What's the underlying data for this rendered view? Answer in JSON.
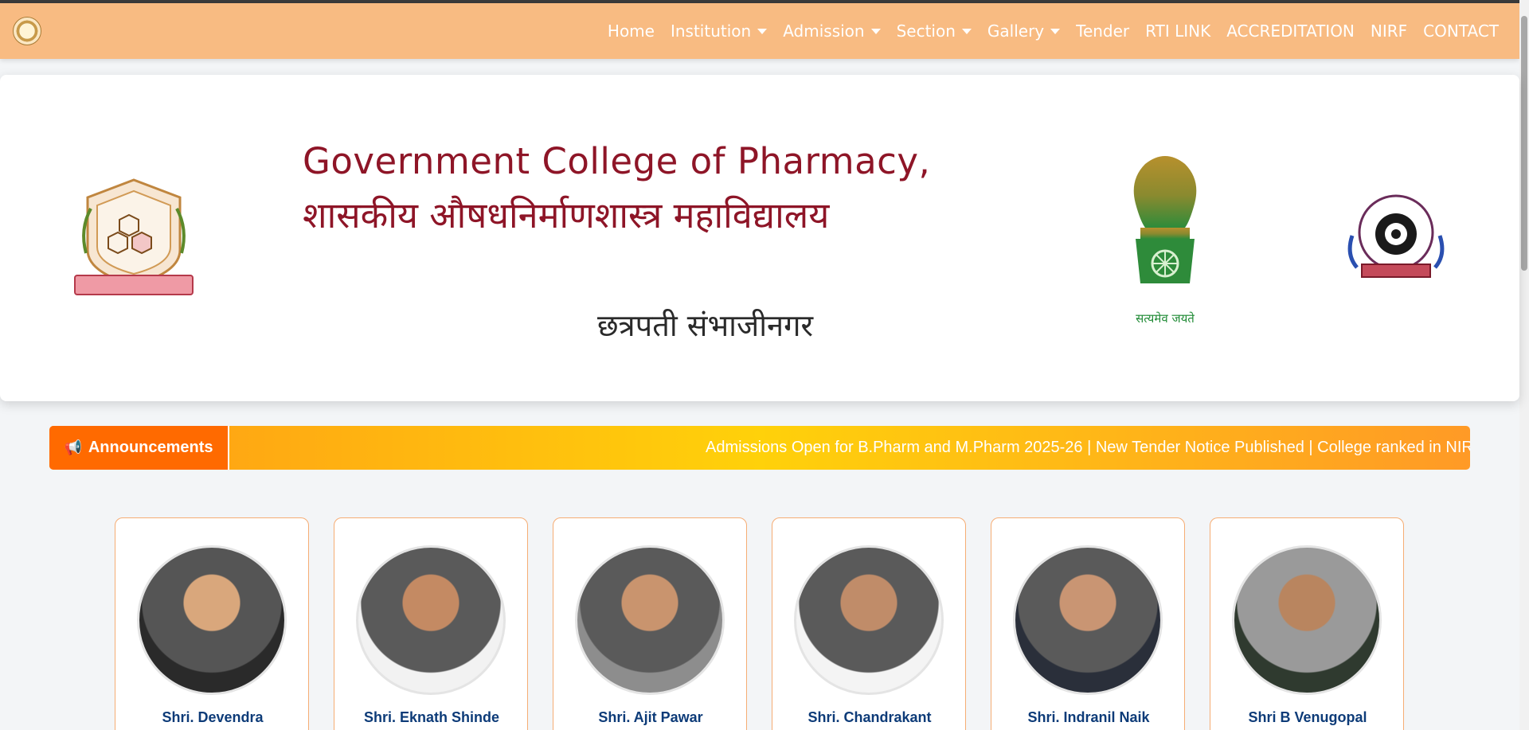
{
  "nav": {
    "items": [
      {
        "label": "Home",
        "dropdown": false
      },
      {
        "label": "Institution",
        "dropdown": true
      },
      {
        "label": "Admission",
        "dropdown": true
      },
      {
        "label": "Section",
        "dropdown": true
      },
      {
        "label": "Gallery",
        "dropdown": true
      },
      {
        "label": "Tender",
        "dropdown": false
      },
      {
        "label": "RTI LINK",
        "dropdown": false
      },
      {
        "label": "ACCREDITATION",
        "dropdown": false
      },
      {
        "label": "NIRF",
        "dropdown": false
      },
      {
        "label": "CONTACT",
        "dropdown": false
      }
    ]
  },
  "header": {
    "title_en": "Government College of Pharmacy,",
    "title_mr": "शासकीय औषधनिर्माणशास्त्र महाविद्यालय",
    "city": "छत्रपती संभाजीनगर",
    "emblem_motto": "सत्यमेव जयते"
  },
  "announcements": {
    "label": "Announcements",
    "text": "Admissions Open for B.Pharm and M.Pharm 2025-26 | New Tender Notice Published | College ranked in NIRF"
  },
  "officials": [
    {
      "name": "Shri. Devendra"
    },
    {
      "name": "Shri. Eknath Shinde"
    },
    {
      "name": "Shri. Ajit Pawar"
    },
    {
      "name": "Shri. Chandrakant"
    },
    {
      "name": "Shri. Indranil Naik"
    },
    {
      "name": "Shri B Venugopal"
    }
  ],
  "colors": {
    "navbar": "#f8bb82",
    "title": "#8e1527",
    "announce_label": "#ff6a00",
    "card_border": "#f6ad74",
    "official_name": "#0d3b78"
  }
}
